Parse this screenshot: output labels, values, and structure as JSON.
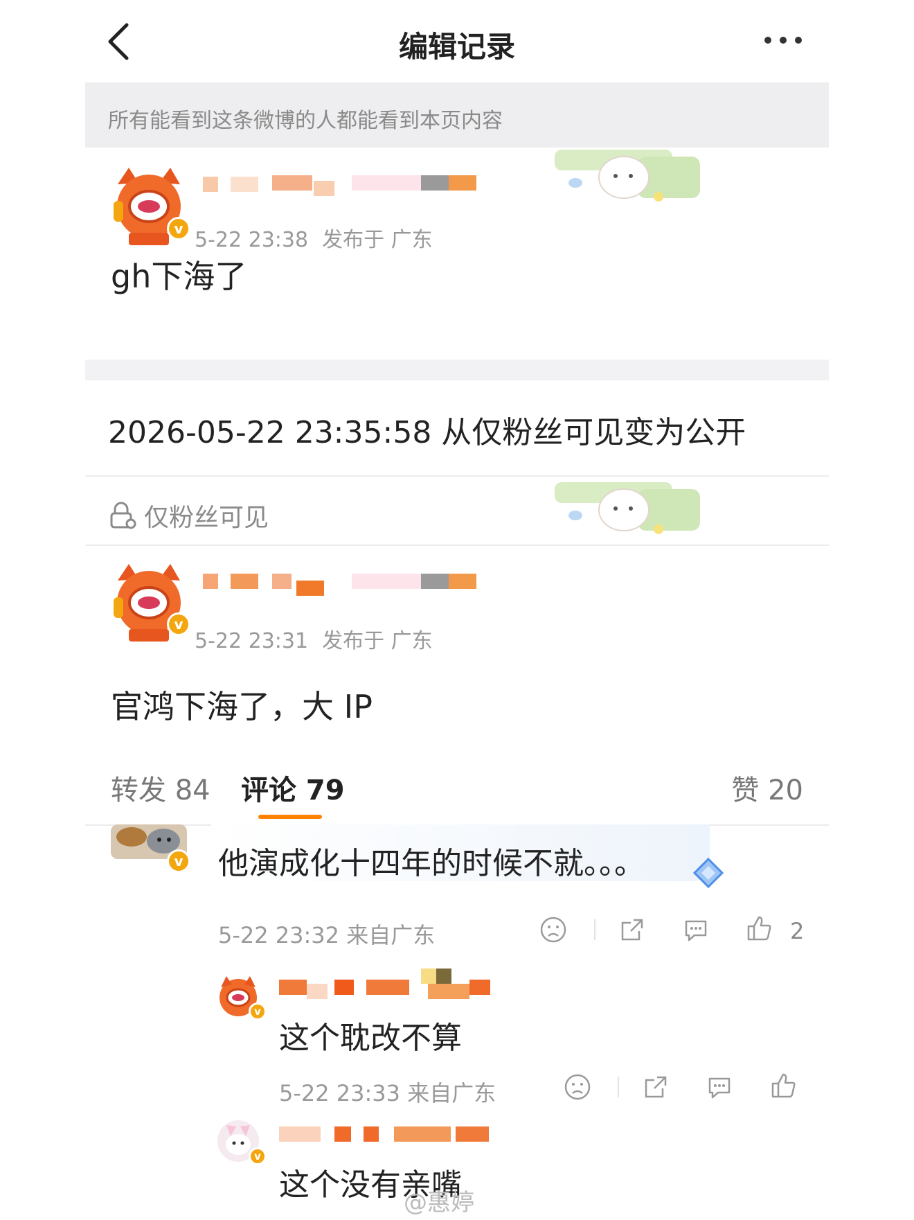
{
  "header": {
    "title": "编辑记录",
    "back_icon": "chevron-left-icon",
    "more_icon": "more-horizontal-icon"
  },
  "notice": "所有能看到这条微博的人都能看到本页内容",
  "post_current": {
    "time": "5-22 23:38",
    "location": "发布于 广东",
    "content": "gh下海了"
  },
  "edit_record": {
    "text": "2026-05-22 23:35:58 从仅粉丝可见变为公开"
  },
  "visibility": {
    "label": "仅粉丝可见",
    "icon": "lock-people-icon"
  },
  "post_previous": {
    "time": "5-22 23:31",
    "location": "发布于 广东",
    "content": "官鸿下海了，大 IP"
  },
  "tabs": {
    "repost": "转发 84",
    "comment": "评论 79",
    "like": "赞 20"
  },
  "comments": [
    {
      "content": "他演成化十四年的时候不就。。。",
      "meta": "5-22 23:32 来自广东",
      "likes": "2"
    },
    {
      "content": "这个耽改不算",
      "meta": "5-22 23:33 来自广东",
      "likes": ""
    },
    {
      "content": "这个没有亲嘴",
      "meta": "",
      "likes": ""
    }
  ],
  "watermark": "@惠婷",
  "colors": {
    "accent": "#ff8200",
    "badge": "#f4a60f",
    "notice_bg": "#eeeef0"
  }
}
